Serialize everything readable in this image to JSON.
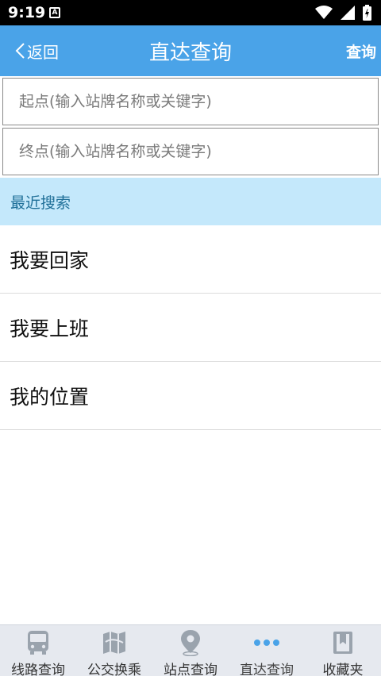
{
  "status_bar": {
    "time": "9:19",
    "notification_letter": "A"
  },
  "nav": {
    "back_label": "返回",
    "title": "直达查询",
    "action_label": "查询"
  },
  "form": {
    "start_placeholder": "起点(输入站牌名称或关键字)",
    "end_placeholder": "终点(输入站牌名称或关键字)"
  },
  "recent": {
    "header": "最近搜索",
    "items": [
      "我要回家",
      "我要上班",
      "我的位置"
    ]
  },
  "tabs": [
    {
      "label": "线路查询",
      "icon": "bus-icon"
    },
    {
      "label": "公交换乘",
      "icon": "map-icon"
    },
    {
      "label": "站点查询",
      "icon": "location-pin-icon"
    },
    {
      "label": "直达查询",
      "icon": "dots-icon",
      "active": true
    },
    {
      "label": "收藏夹",
      "icon": "bookmark-icon"
    }
  ],
  "colors": {
    "nav_bg": "#4aa3e8",
    "section_bg": "#c4e8fb",
    "section_text": "#1f6f98",
    "tab_bg": "#e6e9ef",
    "active_dots": "#4aa3e8"
  }
}
